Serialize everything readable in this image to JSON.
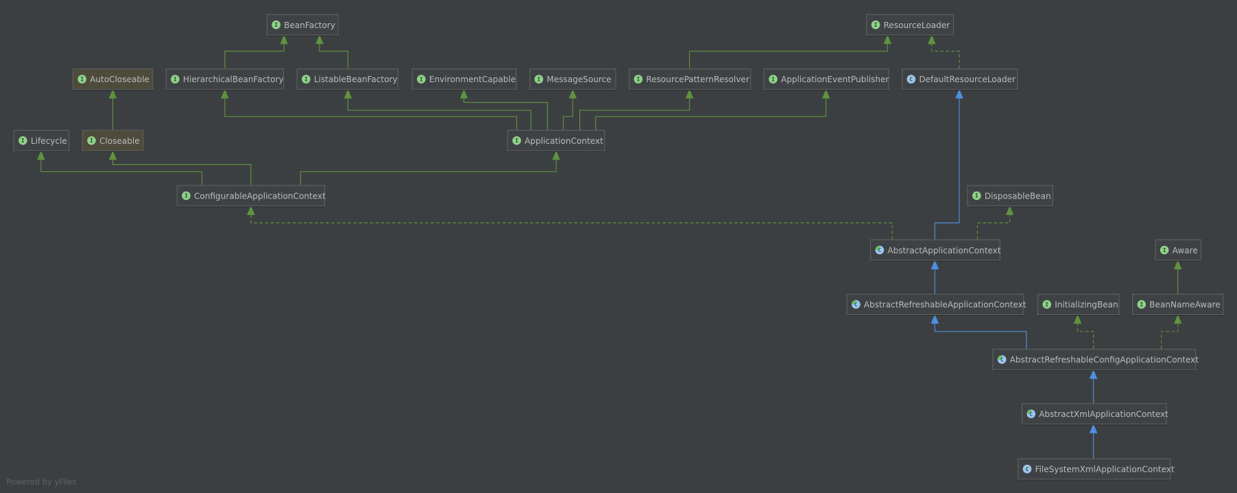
{
  "diagram": {
    "colors": {
      "background": "#3c3f41",
      "interface_icon": "#8fd18a",
      "class_icon": "#9dc7ee",
      "implements_edge": "#5f9340",
      "extends_edge": "#4f8fe0"
    },
    "nodes": [
      {
        "label": "BeanFactory",
        "kind": "interface"
      },
      {
        "label": "ResourceLoader",
        "kind": "interface"
      },
      {
        "label": "AutoCloseable",
        "kind": "interface-jdk"
      },
      {
        "label": "HierarchicalBeanFactory",
        "kind": "interface"
      },
      {
        "label": "ListableBeanFactory",
        "kind": "interface"
      },
      {
        "label": "EnvironmentCapable",
        "kind": "interface"
      },
      {
        "label": "MessageSource",
        "kind": "interface"
      },
      {
        "label": "ResourcePatternResolver",
        "kind": "interface"
      },
      {
        "label": "ApplicationEventPublisher",
        "kind": "interface"
      },
      {
        "label": "DefaultResourceLoader",
        "kind": "class"
      },
      {
        "label": "Lifecycle",
        "kind": "interface"
      },
      {
        "label": "Closeable",
        "kind": "interface-jdk"
      },
      {
        "label": "ApplicationContext",
        "kind": "interface"
      },
      {
        "label": "ConfigurableApplicationContext",
        "kind": "interface"
      },
      {
        "label": "DisposableBean",
        "kind": "interface"
      },
      {
        "label": "AbstractApplicationContext",
        "kind": "abstract-class"
      },
      {
        "label": "Aware",
        "kind": "interface"
      },
      {
        "label": "AbstractRefreshableApplicationContext",
        "kind": "abstract-class"
      },
      {
        "label": "InitializingBean",
        "kind": "interface"
      },
      {
        "label": "BeanNameAware",
        "kind": "interface"
      },
      {
        "label": "AbstractRefreshableConfigApplicationContext",
        "kind": "abstract-class"
      },
      {
        "label": "AbstractXmlApplicationContext",
        "kind": "abstract-class"
      },
      {
        "label": "FileSystemXmlApplicationContext",
        "kind": "class"
      }
    ],
    "interface_icon_letter": "I",
    "class_icon_letter": "C"
  },
  "footer": {
    "text": "Powered by yFiles"
  }
}
